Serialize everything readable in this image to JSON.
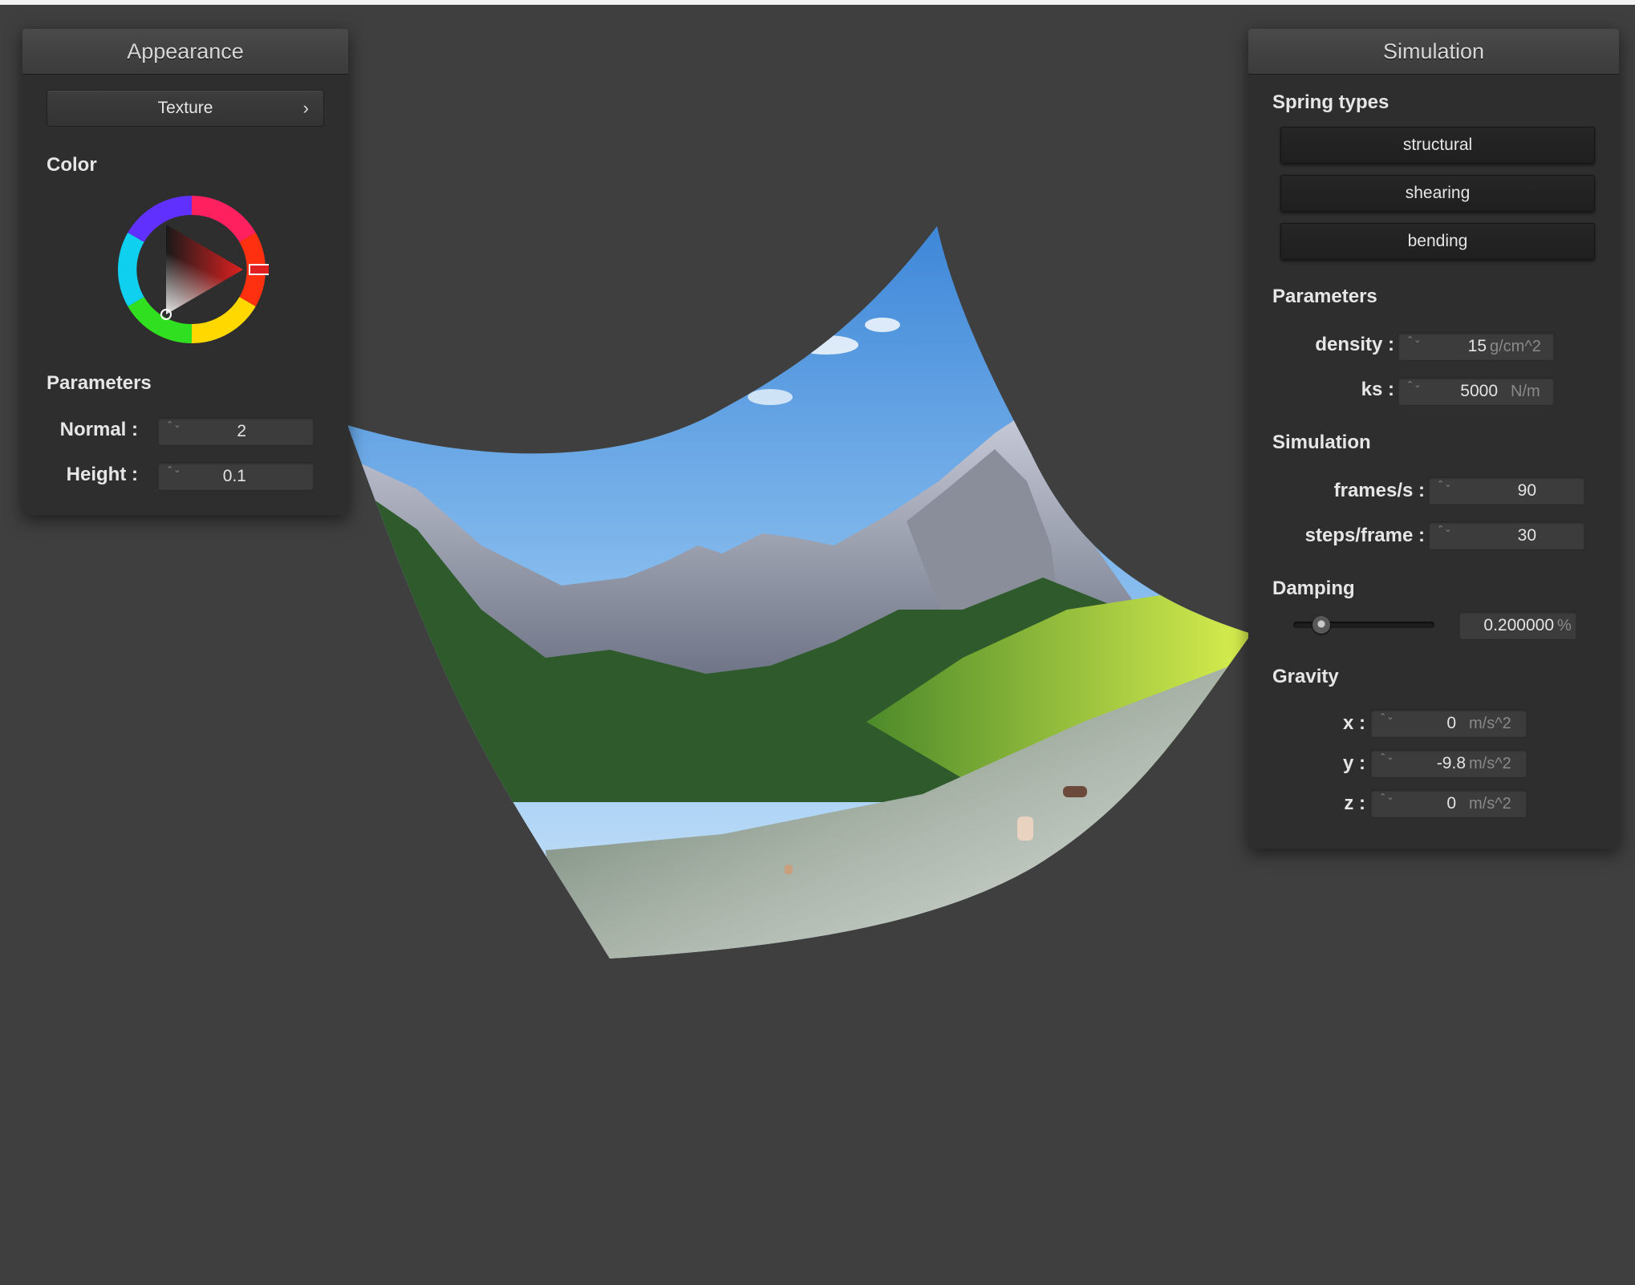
{
  "appearance": {
    "title": "Appearance",
    "texture_button": "Texture",
    "texture_chevron": "›",
    "color_label": "Color",
    "color": "#e02020",
    "parameters_label": "Parameters",
    "normal_label": "Normal :",
    "normal_value": "2",
    "height_label": "Height :",
    "height_value": "0.1"
  },
  "simulation": {
    "title": "Simulation",
    "spring_types_label": "Spring types",
    "spring_types": [
      "structural",
      "shearing",
      "bending"
    ],
    "parameters_label": "Parameters",
    "density_label": "density :",
    "density_value": "15",
    "density_unit": "g/cm^2",
    "ks_label": "ks :",
    "ks_value": "5000",
    "ks_unit": "N/m",
    "simulation_label": "Simulation",
    "fps_label": "frames/s :",
    "fps_value": "90",
    "steps_label": "steps/frame :",
    "steps_value": "30",
    "damping_label": "Damping",
    "damping_slider_level": 0.2,
    "damping_value": "0.200000",
    "damping_unit": "%",
    "gravity_label": "Gravity",
    "gravity_x_label": "x :",
    "gravity_x_value": "0",
    "gravity_y_label": "y :",
    "gravity_y_value": "-9.8",
    "gravity_z_label": "z :",
    "gravity_z_value": "0",
    "gravity_unit": "m/s^2"
  },
  "icons": {
    "spin_arrows": "⌃⌄"
  }
}
